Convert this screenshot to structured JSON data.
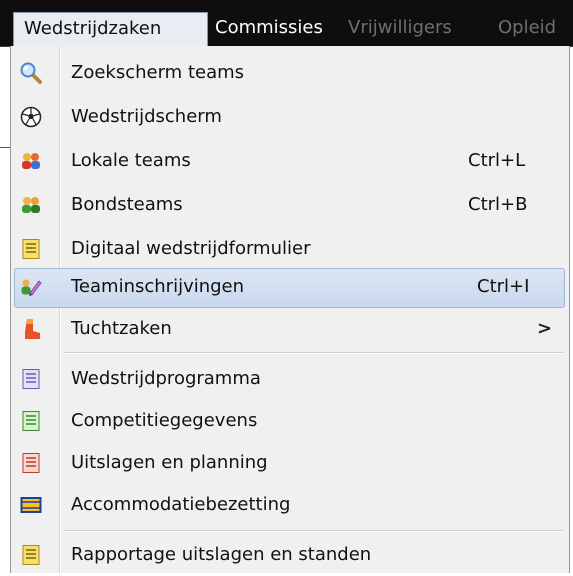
{
  "menubar": {
    "items": [
      {
        "label": "Wedstrijdzaken",
        "state": "active"
      },
      {
        "label": "Commissies",
        "state": "normal"
      },
      {
        "label": "Vrijwilligers",
        "state": "disabled"
      },
      {
        "label": "Opleid",
        "state": "disabled"
      }
    ]
  },
  "dropdown": {
    "items": [
      {
        "label": "Zoekscherm teams",
        "icon": "magnifier-icon",
        "shortcut": ""
      },
      {
        "label": "Wedstrijdscherm",
        "icon": "soccer-ball-icon",
        "shortcut": ""
      },
      {
        "label": "Lokale teams",
        "icon": "people-orange-icon",
        "shortcut": "Ctrl+L"
      },
      {
        "label": "Bondsteams",
        "icon": "people-green-icon",
        "shortcut": "Ctrl+B"
      },
      {
        "label": "Digitaal wedstrijdformulier",
        "icon": "form-yellow-icon",
        "shortcut": ""
      },
      {
        "label": "Teaminschrijvingen",
        "icon": "team-register-icon",
        "shortcut": "Ctrl+I",
        "highlighted": true
      },
      {
        "label": "Tuchtzaken",
        "icon": "boot-icon",
        "shortcut": "",
        "submenu": true
      },
      {
        "label": "Wedstrijdprogramma",
        "icon": "document-purple-icon",
        "shortcut": ""
      },
      {
        "label": "Competitiegegevens",
        "icon": "document-green-icon",
        "shortcut": ""
      },
      {
        "label": "Uitslagen en planning",
        "icon": "document-red-icon",
        "shortcut": ""
      },
      {
        "label": "Accommodatiebezetting",
        "icon": "field-icon",
        "shortcut": ""
      },
      {
        "label": "Rapportage uitslagen en standen",
        "icon": "report-yellow-icon",
        "shortcut": ""
      }
    ],
    "submenu_glyph": ">"
  },
  "colors": {
    "menubar_bg": "#0e0e0e",
    "menu_bg": "#f0f0f0",
    "highlight": "#cddcf0"
  }
}
